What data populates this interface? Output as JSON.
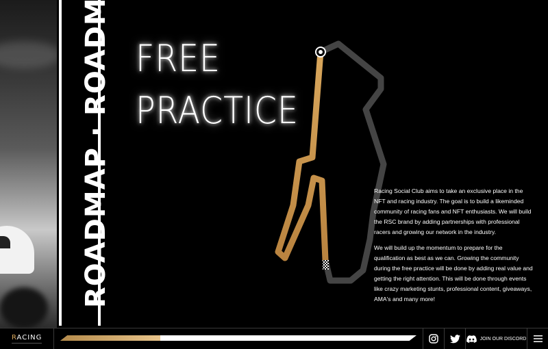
{
  "roadmap_band": {
    "text": "ROADMAP · ROADMAP · ROADMAP · RO"
  },
  "title": {
    "line1": "FREE",
    "line2": "PRACTICE"
  },
  "description": {
    "paragraph1": "Racing Social Club aims to take an exclusive place in the NFT and racing industry. The goal is to build a likeminded community of racing fans and NFT enthusiasts. We will build the RSC brand by adding partnerships with professional racers and growing our network in the industry.",
    "paragraph2": "We will build up the momentum to prepare for the qualification as best as we can. Growing the community during the free practice will be done by adding real value and getting the right attention. This will be done through events like crazy marketing stunts, professional content, giveaways, AMA's and many more!"
  },
  "footer": {
    "logo_r": "R",
    "logo_rest": "ACING",
    "progress_fraction": 0.28,
    "discord_label": "JOIN OUR DISCORD",
    "icons": {
      "instagram": "instagram-icon",
      "twitter": "twitter-icon",
      "discord": "discord-icon",
      "menu": "hamburger-menu-icon"
    }
  },
  "colors": {
    "gold": "#d9a75c",
    "gold_light": "#e7c38a",
    "track_grey": "#444444",
    "background": "#000000"
  }
}
